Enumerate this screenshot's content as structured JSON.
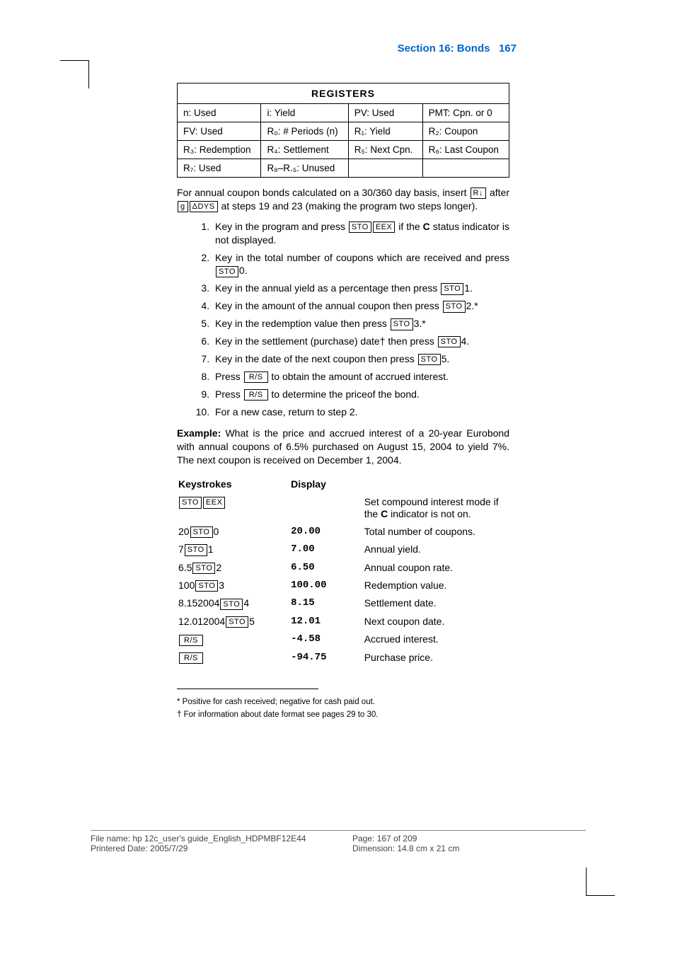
{
  "header": {
    "section": "Section 16: Bonds",
    "page": "167"
  },
  "registers": {
    "title": "REGISTERS",
    "rows": [
      [
        "n: Used",
        "i: Yield",
        "PV: Used",
        "PMT: Cpn. or 0"
      ],
      [
        "FV: Used",
        "R₀: # Periods (n)",
        "R₁: Yield",
        "R₂: Coupon"
      ],
      [
        "R₃: Redemption",
        "R₄: Settlement",
        "R₅: Next Cpn.",
        "R₆: Last Coupon"
      ],
      [
        "R₇: Used",
        "R₈–R.₅: Unused",
        "",
        ""
      ]
    ]
  },
  "intro": {
    "text_before": "For annual coupon bonds calculated on a 30/360 day basis, insert ",
    "key1": "R↓",
    "text_mid": " after ",
    "key2a": "g",
    "key2b": "ΔDYS",
    "text_after": " at steps 19 and 23 (making the program two steps longer)."
  },
  "steps": [
    {
      "pre": "Key in the program and press ",
      "k": [
        "STO",
        "EEX"
      ],
      "post": " if the ",
      "bold": "C",
      "post2": " status indicator is not displayed."
    },
    {
      "pre": "Key in the total number of coupons which are received and press ",
      "k": [
        "STO"
      ],
      "post": "0."
    },
    {
      "pre": "Key in the annual yield as a percentage then press ",
      "k": [
        "STO"
      ],
      "post": "1."
    },
    {
      "pre": "Key in the amount of the annual coupon then press ",
      "k": [
        "STO"
      ],
      "post": "2.*"
    },
    {
      "pre": "Key in the redemption value then press ",
      "k": [
        "STO"
      ],
      "post": "3.*"
    },
    {
      "pre": "Key in the settlement (purchase) date† then press ",
      "k": [
        "STO"
      ],
      "post": "4."
    },
    {
      "pre": "Key in the date of the next coupon then press ",
      "k": [
        "STO"
      ],
      "post": "5."
    },
    {
      "pre": "Press ",
      "k": [
        "R/S"
      ],
      "post": " to obtain the amount of accrued interest."
    },
    {
      "pre": "Press ",
      "k": [
        "R/S"
      ],
      "post": " to determine the priceof the bond."
    },
    {
      "pre": "For a new case, return to step 2.",
      "k": [],
      "post": ""
    }
  ],
  "example": {
    "label": "Example:",
    "text": " What is the price and accrued interest of a 20-year Eurobond with annual coupons of 6.5% purchased on August 15, 2004 to yield 7%. The next coupon is received on December 1, 2004."
  },
  "ex_headers": {
    "c1": "Keystrokes",
    "c2": "Display",
    "c3": ""
  },
  "ex_rows": [
    {
      "ks_pre": "",
      "keys": [
        "STO",
        "EEX"
      ],
      "ks_post": "",
      "disp": "",
      "desc_pre": "Set compound interest mode if the ",
      "desc_bold": "C",
      "desc_post": " indicator is not on."
    },
    {
      "ks_pre": "20",
      "keys": [
        "STO"
      ],
      "ks_post": "0",
      "disp": "20.00",
      "desc_pre": "Total number of coupons.",
      "desc_bold": "",
      "desc_post": ""
    },
    {
      "ks_pre": "7",
      "keys": [
        "STO"
      ],
      "ks_post": "1",
      "disp": "7.00",
      "desc_pre": "Annual yield.",
      "desc_bold": "",
      "desc_post": ""
    },
    {
      "ks_pre": "6.5",
      "keys": [
        "STO"
      ],
      "ks_post": "2",
      "disp": "6.50",
      "desc_pre": "Annual coupon rate.",
      "desc_bold": "",
      "desc_post": ""
    },
    {
      "ks_pre": "100",
      "keys": [
        "STO"
      ],
      "ks_post": "3",
      "disp": "100.00",
      "desc_pre": "Redemption value.",
      "desc_bold": "",
      "desc_post": ""
    },
    {
      "ks_pre": "8.152004",
      "keys": [
        "STO"
      ],
      "ks_post": "4",
      "disp": "8.15",
      "desc_pre": "Settlement date.",
      "desc_bold": "",
      "desc_post": ""
    },
    {
      "ks_pre": "12.012004",
      "keys": [
        "STO"
      ],
      "ks_post": "5",
      "disp": "12.01",
      "desc_pre": "Next coupon date.",
      "desc_bold": "",
      "desc_post": ""
    },
    {
      "ks_pre": "",
      "keys": [
        "R/S"
      ],
      "ks_post": "",
      "disp": "-4.58",
      "desc_pre": "Accrued interest.",
      "desc_bold": "",
      "desc_post": ""
    },
    {
      "ks_pre": "",
      "keys": [
        "R/S"
      ],
      "ks_post": "",
      "disp": "-94.75",
      "desc_pre": "Purchase price.",
      "desc_bold": "",
      "desc_post": ""
    }
  ],
  "footnotes": {
    "f1": "* Positive for cash received; negative for cash paid out.",
    "f2": "† For information about date format see pages 29 to 30."
  },
  "footer": {
    "file": "File name: hp 12c_user's guide_English_HDPMBF12E44",
    "page": "Page: 167 of 209",
    "date": "Printered Date: 2005/7/29",
    "dim": "Dimension: 14.8 cm x 21 cm"
  }
}
